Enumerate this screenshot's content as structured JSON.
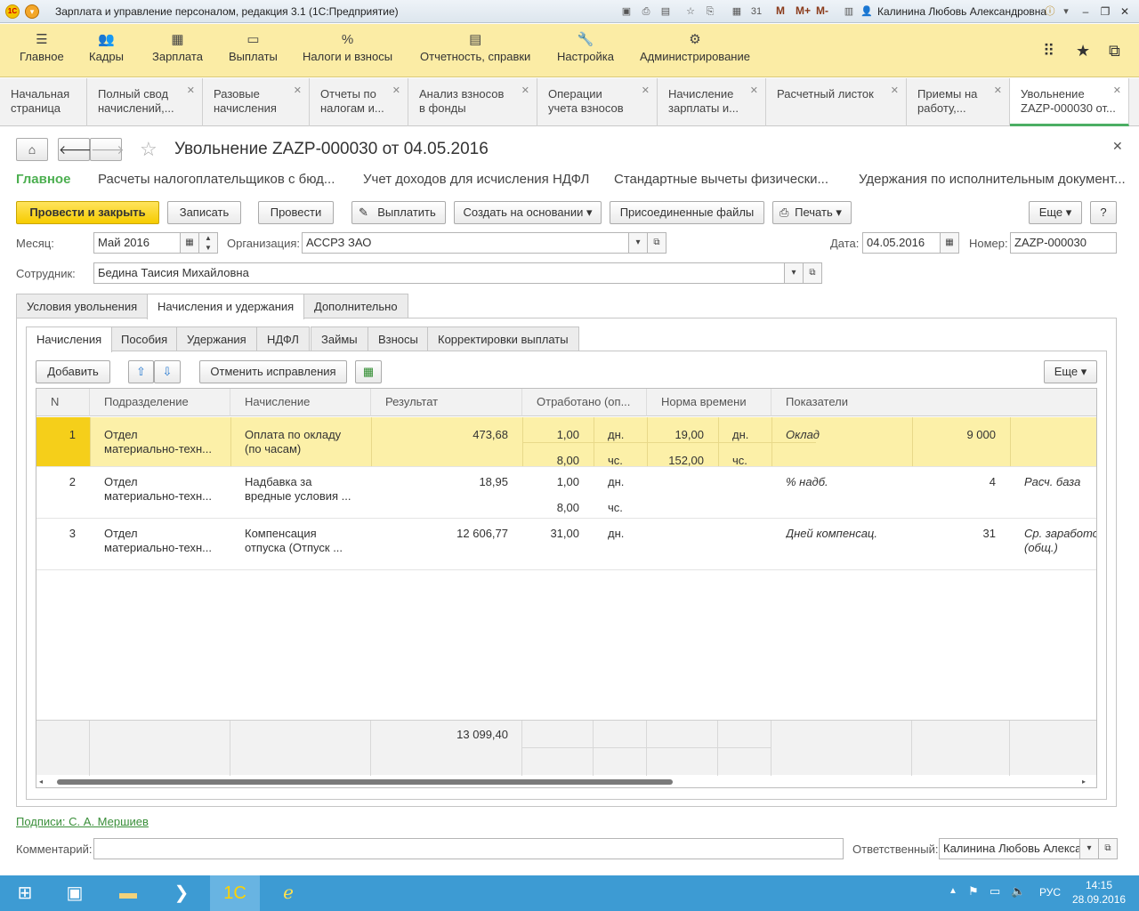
{
  "titlebar": {
    "app_title": "Зарплата и управление персоналом, редакция 3.1  (1С:Предприятие)",
    "m_buttons": [
      "M",
      "M+",
      "M-"
    ],
    "user": "Калинина Любовь Александровна"
  },
  "sections": [
    {
      "icon": "☰",
      "label": "Главное"
    },
    {
      "icon": "👥",
      "label": "Кадры"
    },
    {
      "icon": "▦",
      "label": "Зарплата"
    },
    {
      "icon": "▭",
      "label": "Выплаты"
    },
    {
      "icon": "%",
      "label": "Налоги и взносы"
    },
    {
      "icon": "▤",
      "label": "Отчетность, справки"
    },
    {
      "icon": "🔧",
      "label": "Настройка"
    },
    {
      "icon": "⚙",
      "label": "Администрирование"
    }
  ],
  "window_tabs": [
    {
      "l1": "Начальная",
      "l2": "страница"
    },
    {
      "l1": "Полный свод",
      "l2": "начислений,..."
    },
    {
      "l1": "Разовые",
      "l2": "начисления"
    },
    {
      "l1": "Отчеты по",
      "l2": "налогам и..."
    },
    {
      "l1": "Анализ взносов",
      "l2": "в фонды"
    },
    {
      "l1": "Операции",
      "l2": "учета взносов"
    },
    {
      "l1": "Начисление",
      "l2": "зарплаты и..."
    },
    {
      "l1": "Расчетный листок",
      "l2": ""
    },
    {
      "l1": "Приемы на",
      "l2": "работу,..."
    },
    {
      "l1": "Увольнение",
      "l2": "ZAZP-000030 от..."
    }
  ],
  "form": {
    "title": "Увольнение ZAZP-000030 от 04.05.2016",
    "links": [
      "Главное",
      "Расчеты налогоплательщиков с бюд...",
      "Учет доходов для исчисления НДФЛ",
      "Стандартные вычеты физически...",
      "Удержания по исполнительным документ..."
    ],
    "buttons": {
      "post_close": "Провести и закрыть",
      "save": "Записать",
      "post": "Провести",
      "pay": "Выплатить",
      "create_based": "Создать на основании",
      "attached": "Присоединенные файлы",
      "print": "Печать",
      "more": "Еще",
      "help": "?"
    },
    "month_label": "Месяц:",
    "month_value": "Май 2016",
    "org_label": "Организация:",
    "org_value": "АССРЗ ЗАО",
    "date_label": "Дата:",
    "date_value": "04.05.2016",
    "number_label": "Номер:",
    "number_value": "ZAZP-000030",
    "employee_label": "Сотрудник:",
    "employee_value": "Бедина Таисия Михайловна"
  },
  "page_tabs": [
    "Условия увольнения",
    "Начисления и удержания",
    "Дополнительно"
  ],
  "inner_tabs": [
    "Начисления",
    "Пособия",
    "Удержания",
    "НДФЛ",
    "Займы",
    "Взносы",
    "Корректировки выплаты"
  ],
  "grid_toolbar": {
    "add": "Добавить",
    "cancel_fix": "Отменить исправления",
    "more": "Еще"
  },
  "grid": {
    "columns": [
      "N",
      "Подразделение",
      "Начисление",
      "Результат",
      "Отработано (оп...",
      "Норма времени",
      "Показатели"
    ],
    "rows": [
      {
        "n": "1",
        "dept1": "Отдел",
        "dept2": "материально-техн...",
        "acc1": "Оплата по окладу",
        "acc2": "(по часам)",
        "result": "473,68",
        "worked1": "1,00",
        "unit1": "дн.",
        "worked2": "8,00",
        "unit2": "чс.",
        "norm1": "19,00",
        "nunit1": "дн.",
        "norm2": "152,00",
        "nunit2": "чс.",
        "ind_name": "Оклад",
        "ind_value": "9 000",
        "ind_extra1": "",
        "ind_extra2": ""
      },
      {
        "n": "2",
        "dept1": "Отдел",
        "dept2": "материально-техн...",
        "acc1": "Надбавка за",
        "acc2": "вредные условия ...",
        "result": "18,95",
        "worked1": "1,00",
        "unit1": "дн.",
        "worked2": "8,00",
        "unit2": "чс.",
        "norm1": "",
        "nunit1": "",
        "norm2": "",
        "nunit2": "",
        "ind_name": "% надб.",
        "ind_value": "4",
        "ind_extra1": "Расч. база",
        "ind_extra2": ""
      },
      {
        "n": "3",
        "dept1": "Отдел",
        "dept2": "материально-техн...",
        "acc1": "Компенсация",
        "acc2": "отпуска (Отпуск ...",
        "result": "12 606,77",
        "worked1": "31,00",
        "unit1": "дн.",
        "worked2": "",
        "unit2": "",
        "norm1": "",
        "nunit1": "",
        "norm2": "",
        "nunit2": "",
        "ind_name": "Дней компенсац.",
        "ind_value": "31",
        "ind_extra1": "Ср. заработок",
        "ind_extra2": "(общ.)"
      }
    ],
    "total_result": "13 099,40"
  },
  "signatures": "Подписи: С. А. Мершиев",
  "comment_label": "Комментарий:",
  "comment_value": "",
  "responsible_label": "Ответственный:",
  "responsible_value": "Калинина Любовь Александровна",
  "taskbar": {
    "lang": "РУС",
    "time": "14:15",
    "date": "28.09.2016"
  }
}
